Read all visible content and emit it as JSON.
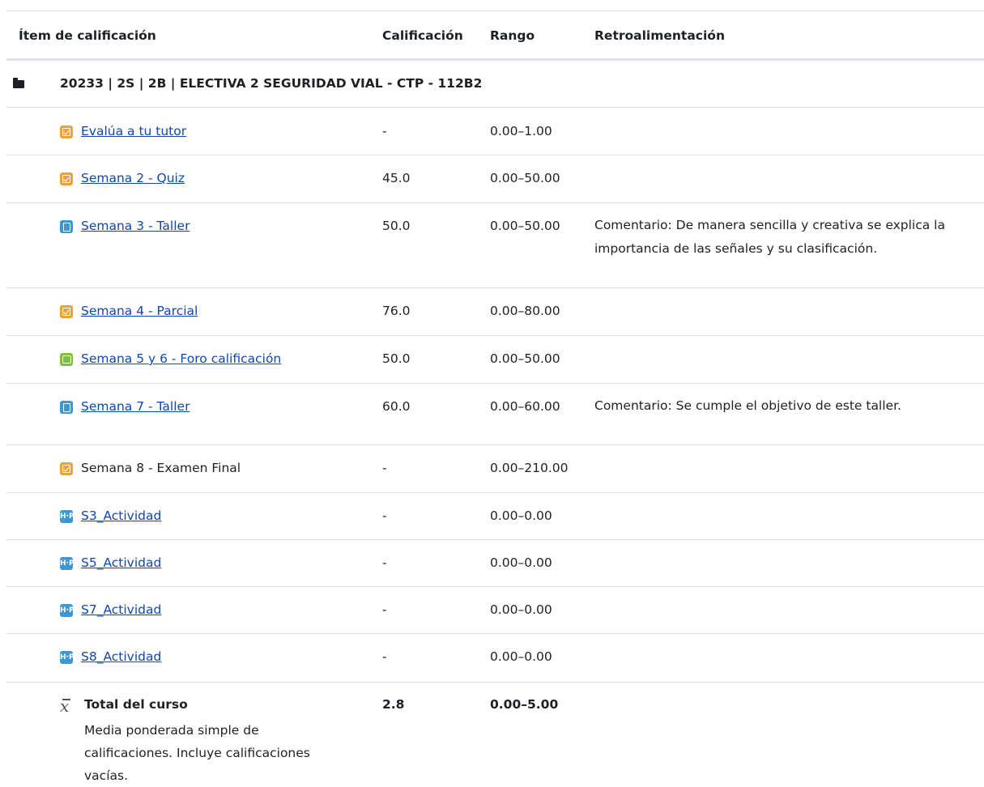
{
  "table": {
    "headers": {
      "item": "Ítem de calificación",
      "grade": "Calificación",
      "range": "Rango",
      "feedback": "Retroalimentación"
    },
    "category": "20233 | 2S | 2B | ELECTIVA 2 SEGURIDAD VIAL - CTP - 112B2",
    "rows": [
      {
        "icon": "quiz-icon",
        "name": "Evalúa a tu tutor",
        "grade": "-",
        "range": "0.00–1.00",
        "feedback": "",
        "link": true
      },
      {
        "icon": "quiz-icon",
        "name": "Semana 2 - Quiz",
        "grade": "45.0",
        "range": "0.00–50.00",
        "feedback": "",
        "link": true
      },
      {
        "icon": "assignment-icon",
        "name": "Semana 3 - Taller",
        "grade": "50.0",
        "range": "0.00–50.00",
        "feedback": "Comentario: De manera sencilla y creativa se explica la importancia de las señales y su clasificación.",
        "link": true
      },
      {
        "icon": "quiz-icon",
        "name": "Semana 4 - Parcial",
        "grade": "76.0",
        "range": "0.00–80.00",
        "feedback": "",
        "link": true
      },
      {
        "icon": "forum-icon",
        "name": "Semana 5 y 6 - Foro calificación",
        "grade": "50.0",
        "range": "0.00–50.00",
        "feedback": "",
        "link": true
      },
      {
        "icon": "assignment-icon",
        "name": "Semana 7 - Taller",
        "grade": "60.0",
        "range": "0.00–60.00",
        "feedback": "Comentario: Se cumple el objetivo de este taller.",
        "link": true
      },
      {
        "icon": "quiz-icon",
        "name": "Semana 8 - Examen Final",
        "grade": "-",
        "range": "0.00–210.00",
        "feedback": "",
        "link": false
      },
      {
        "icon": "h5p-icon",
        "name": "S3_Actividad",
        "grade": "-",
        "range": "0.00–0.00",
        "feedback": "",
        "link": true
      },
      {
        "icon": "h5p-icon",
        "name": "S5_Actividad",
        "grade": "-",
        "range": "0.00–0.00",
        "feedback": "",
        "link": true
      },
      {
        "icon": "h5p-icon",
        "name": "S7_Actividad",
        "grade": "-",
        "range": "0.00–0.00",
        "feedback": "",
        "link": true
      },
      {
        "icon": "h5p-icon",
        "name": "S8_Actividad",
        "grade": "-",
        "range": "0.00–0.00",
        "feedback": "",
        "link": true
      }
    ],
    "total": {
      "icon": "mean-icon",
      "name": "Total del curso",
      "description": "Media ponderada simple de calificaciones. Incluye calificaciones vacías.",
      "grade": "2.8",
      "range": "0.00–5.00"
    },
    "h5p_icon_text": "H·P",
    "colors": {
      "link": "#0f47ad",
      "quiz": "#eaa23a",
      "assignment": "#3f96d0",
      "forum": "#7fbf3f",
      "border": "#dee2e6"
    }
  }
}
